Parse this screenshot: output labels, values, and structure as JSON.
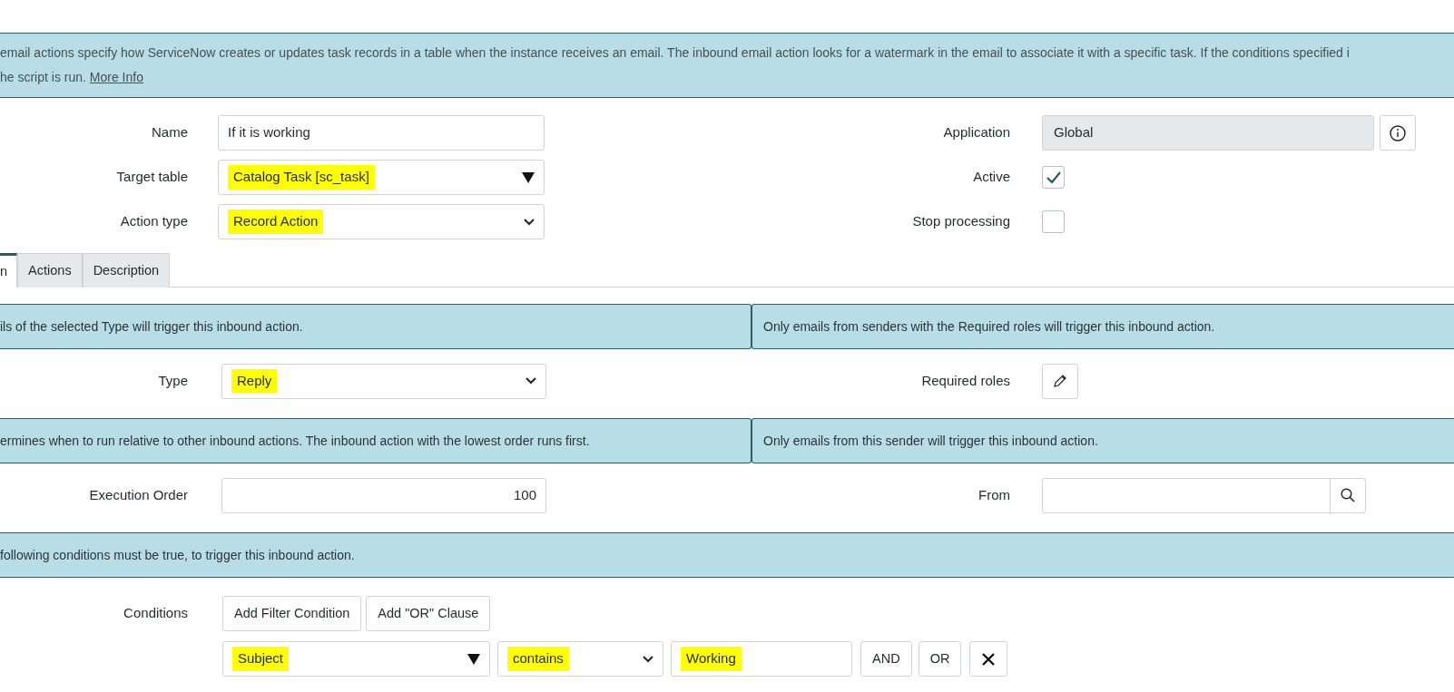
{
  "banner": {
    "lines": [
      "email actions specify how ServiceNow creates or updates task records in a table when the instance receives an email. The inbound email action looks for a watermark in the email to associate it with a specific task. If the conditions specified i",
      "he script is run."
    ],
    "link": "More Info"
  },
  "fields_left": [
    {
      "label": "Name",
      "kind": "text",
      "value": "If it is working",
      "highlighted": false
    },
    {
      "label": "Target table",
      "kind": "reference",
      "value": "Catalog Task [sc_task]",
      "highlighted": true
    },
    {
      "label": "Action type",
      "kind": "select",
      "value": "Record Action",
      "highlighted": true
    }
  ],
  "fields_right": [
    {
      "label": "Application",
      "kind": "readonly",
      "value": "Global"
    },
    {
      "label": "Active",
      "kind": "checkbox",
      "checked": true
    },
    {
      "label": "Stop processing",
      "kind": "checkbox",
      "checked": false
    }
  ],
  "tabs": [
    {
      "label": "n",
      "selected": true
    },
    {
      "label": "Actions",
      "selected": false
    },
    {
      "label": "Description",
      "selected": false
    }
  ],
  "sections": [
    {
      "info_left": "ils of the selected Type will trigger this inbound action.",
      "info_right": "Only emails from senders with the Required roles will trigger this inbound action.",
      "left": {
        "label": "Type",
        "kind": "select",
        "value": "Reply",
        "highlighted": true
      },
      "right": {
        "label": "Required roles",
        "kind": "roles"
      }
    },
    {
      "info_left": "ermines when to run relative to other inbound actions. The inbound action with the lowest order runs first.",
      "info_right": "Only emails from this sender will trigger this inbound action.",
      "left": {
        "label": "Execution Order",
        "kind": "number",
        "value": "100",
        "highlighted": false
      },
      "right": {
        "label": "From",
        "kind": "lookup"
      }
    },
    {
      "info_left": "following conditions must be true, to trigger this inbound action."
    }
  ],
  "conditions": {
    "label": "Conditions",
    "buttons": [
      "Add Filter Condition",
      "Add \"OR\" Clause"
    ],
    "row": {
      "field": {
        "value": "Subject",
        "highlighted": true
      },
      "operator": {
        "value": "contains",
        "highlighted": true
      },
      "input": {
        "value": "Working",
        "highlighted": true
      },
      "buttons": [
        "AND",
        "OR"
      ]
    }
  }
}
